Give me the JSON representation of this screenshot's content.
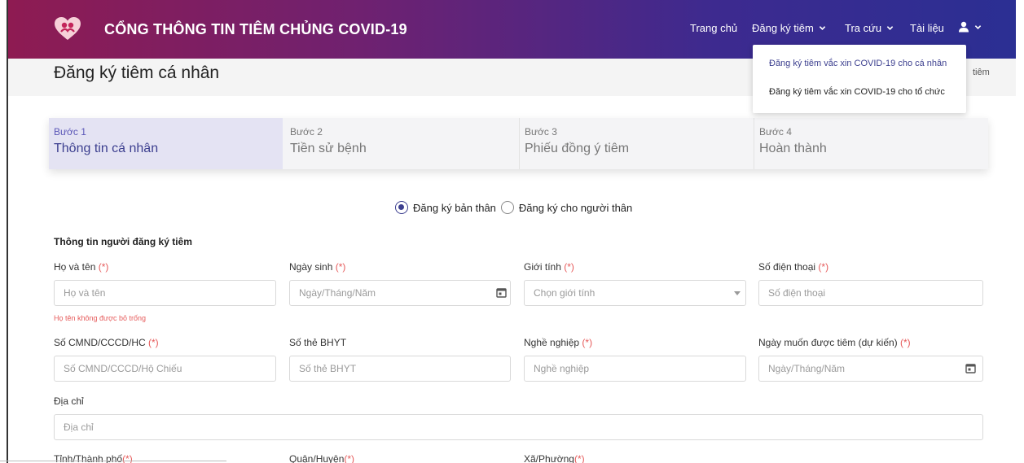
{
  "header": {
    "site_title": "CỔNG THÔNG TIN TIÊM CHỦNG COVID-19",
    "nav": {
      "home": "Trang chủ",
      "register": "Đăng ký tiêm",
      "lookup": "Tra cứu",
      "docs": "Tài liệu"
    },
    "register_menu": [
      "Đăng ký tiêm vắc xin COVID-19 cho cá nhân",
      "Đăng ký tiêm vắc xin COVID-19 cho tổ chức"
    ],
    "colors": {
      "gradient_start": "#8e1b52",
      "gradient_end": "#2b2f93"
    }
  },
  "page": {
    "title": "Đăng ký tiêm cá nhân",
    "crumb_tail": "tiêm"
  },
  "steps": [
    {
      "no": "Bước 1",
      "name": "Thông tin cá nhân",
      "active": true
    },
    {
      "no": "Bước 2",
      "name": "Tiền sử bệnh",
      "active": false
    },
    {
      "no": "Bước 3",
      "name": "Phiếu đồng ý tiêm",
      "active": false
    },
    {
      "no": "Bước 4",
      "name": "Hoàn thành",
      "active": false
    }
  ],
  "registration_type": {
    "options": [
      "Đăng ký bản thân",
      "Đăng ký cho người thân"
    ],
    "selected": "Đăng ký bản thân"
  },
  "form": {
    "section_title": "Thông tin người đăng ký tiêm",
    "required_mark": "(*)",
    "full_name": {
      "label": "Họ và tên",
      "placeholder": "Họ và tên",
      "error": "Họ tên không được bỏ trống"
    },
    "dob": {
      "label": "Ngày sinh",
      "placeholder": "Ngày/Tháng/Năm"
    },
    "gender": {
      "label": "Giới tính",
      "placeholder": "Chọn giới tính"
    },
    "phone": {
      "label": "Số điện thoại",
      "placeholder": "Số điện thoại"
    },
    "id_number": {
      "label": "Số CMND/CCCD/HC",
      "placeholder": "Số CMND/CCCD/Hộ Chiếu"
    },
    "insurance": {
      "label": "Số thẻ BHYT",
      "placeholder": "Số thẻ BHYT"
    },
    "occupation": {
      "label": "Nghề nghiệp",
      "placeholder": "Nghề nghiệp"
    },
    "desired_date": {
      "label": "Ngày muốn được tiêm (dự kiến)",
      "placeholder": "Ngày/Tháng/Năm"
    },
    "address": {
      "label": "Địa chỉ",
      "placeholder": "Địa chỉ"
    },
    "province": {
      "label": "Tỉnh/Thành phố"
    },
    "district": {
      "label": "Quận/Huyện"
    },
    "ward": {
      "label": "Xã/Phường"
    }
  }
}
